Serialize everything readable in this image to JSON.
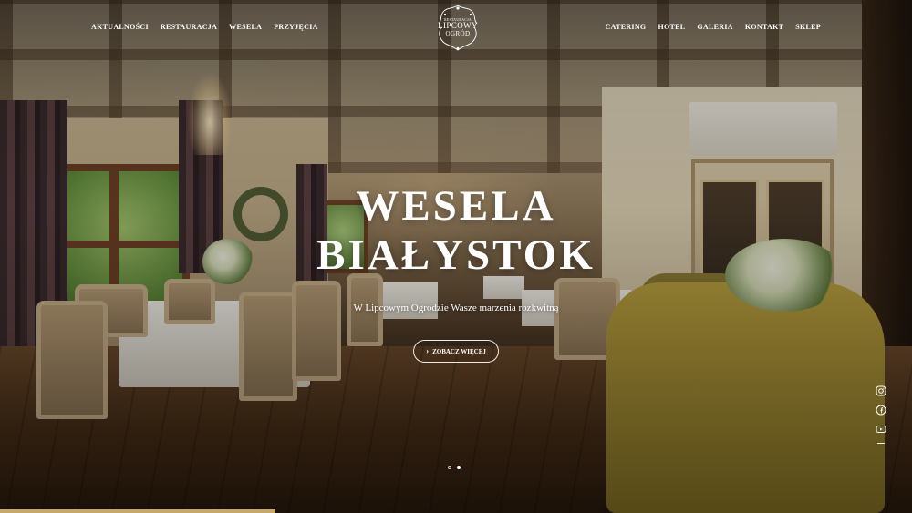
{
  "nav_left": [
    {
      "label": "AKTUALNOŚCI"
    },
    {
      "label": "RESTAURACJA"
    },
    {
      "label": "WESELA"
    },
    {
      "label": "PRZYJĘCIA"
    }
  ],
  "nav_right": [
    {
      "label": "CATERING"
    },
    {
      "label": "HOTEL"
    },
    {
      "label": "GALERIA"
    },
    {
      "label": "KONTAKT"
    },
    {
      "label": "SKLEP"
    }
  ],
  "logo": {
    "top_text": "RESTAURACJA",
    "name_line1": "LIPCOWY",
    "name_line2": "OGRÓD"
  },
  "hero": {
    "title_line1": "WESELA",
    "title_line2": "BIAŁYSTOK",
    "subtitle": "W Lipcowym Ogrodzie Wasze marzenia rozkwitną",
    "cta_icon": "chevron-right-icon",
    "cta_label": "ZOBACZ WIĘCEJ"
  },
  "social": [
    "instagram-icon",
    "facebook-icon",
    "youtube-icon"
  ],
  "slider": {
    "slides": 2,
    "active": 2
  },
  "colors": {
    "accent": "#c6a86a",
    "text": "#ffffff"
  }
}
